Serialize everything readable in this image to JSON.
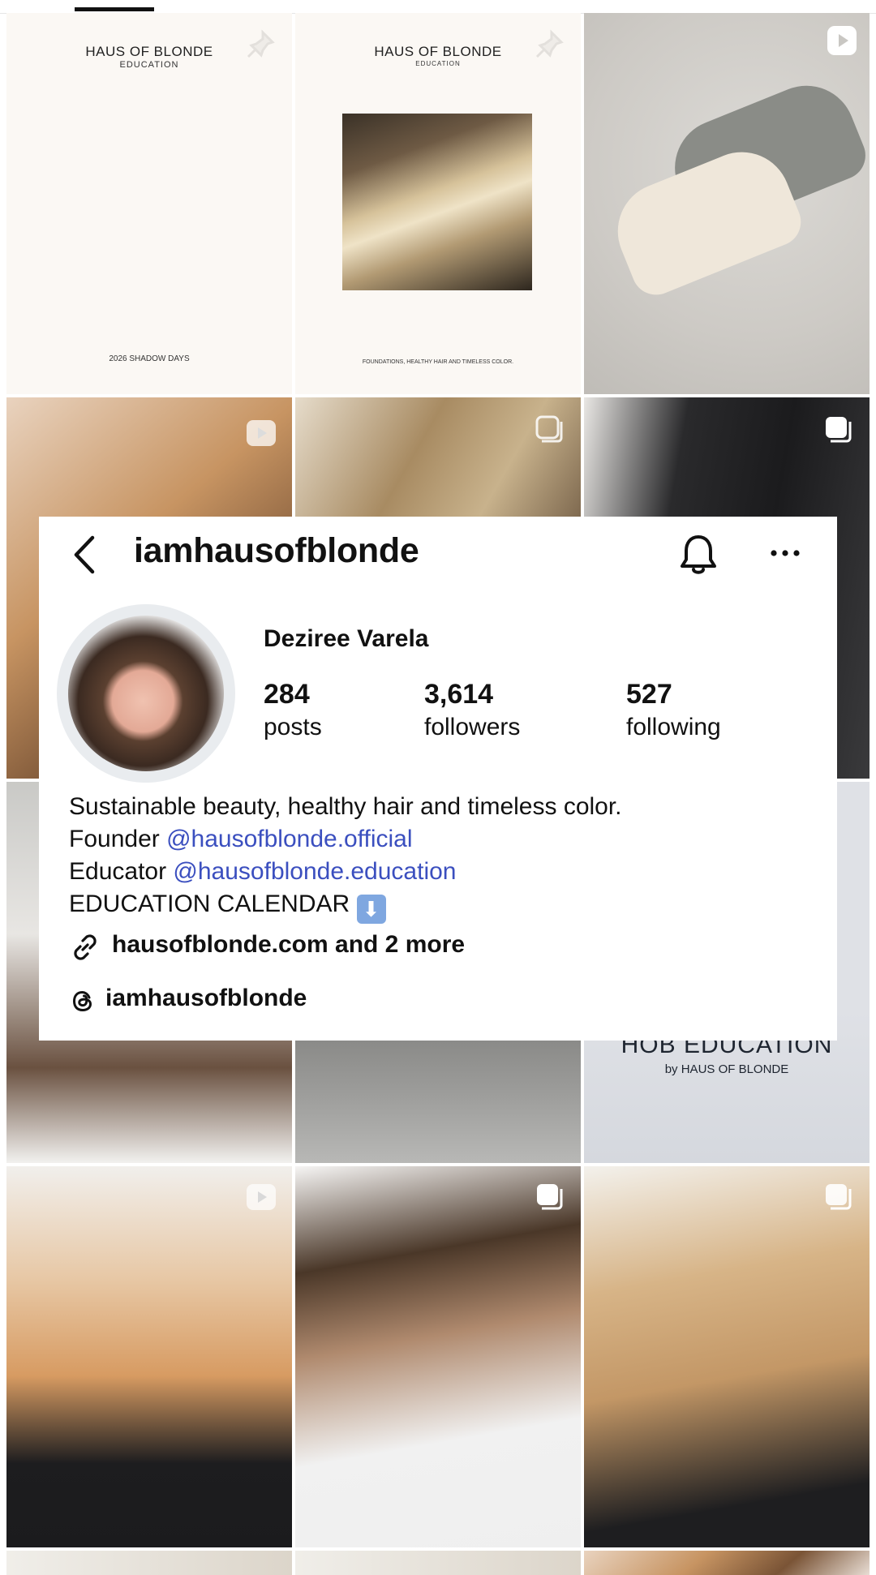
{
  "header": {
    "username": "iamhausofblonde"
  },
  "profile": {
    "display_name": "Deziree Varela",
    "stats": {
      "posts_count": "284",
      "posts_label": "posts",
      "followers_count": "3,614",
      "followers_label": "followers",
      "following_count": "527",
      "following_label": "following"
    },
    "bio": {
      "line1": "Sustainable beauty, healthy hair and timeless color.",
      "line2_prefix": "Founder ",
      "line2_mention": "@hausofblonde.official",
      "line3_prefix": "Educator ",
      "line3_mention": "@hausofblonde.education",
      "line4_text": "EDUCATION CALENDAR ",
      "line4_emoji": "⬇"
    },
    "link_text": "hausofblonde.com and 2 more",
    "threads_text": "iamhausofblonde"
  },
  "grid": {
    "tile1": {
      "title": "HAUS OF BLONDE",
      "subtitle": "EDUCATION",
      "footer": "2026 SHADOW DAYS"
    },
    "tile2": {
      "title": "HAUS OF BLONDE",
      "subtitle": "EDUCATION",
      "footer": "FOUNDATIONS, HEALTHY HAIR AND TIMELESS COLOR."
    },
    "tile9": {
      "title": "HOB EDUCATION",
      "subtitle": "by HAUS OF BLONDE"
    }
  },
  "colors": {
    "mention": "#3b4fbf",
    "text": "#111111"
  },
  "icons": [
    "back-arrow-icon",
    "bell-icon",
    "more-icon",
    "link-icon",
    "threads-icon",
    "pin-icon",
    "reel-icon",
    "carousel-icon"
  ]
}
